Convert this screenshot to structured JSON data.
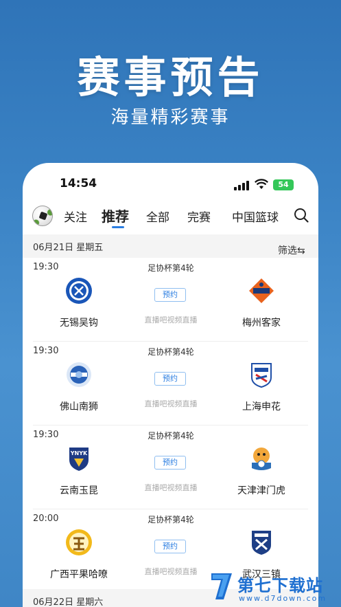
{
  "hero": {
    "title": "赛事预告",
    "subtitle": "海量精彩赛事"
  },
  "status_bar": {
    "time": "14:54",
    "battery": "54"
  },
  "tabs": [
    {
      "label": "关注"
    },
    {
      "label": "推荐",
      "active": true
    },
    {
      "label": "全部"
    },
    {
      "label": "完赛"
    },
    {
      "label": "中国篮球"
    }
  ],
  "date_header": {
    "date": "06月21日 星期五",
    "filter_label": "筛选⇆"
  },
  "matches": [
    {
      "time": "19:30",
      "league": "足协杯第4轮",
      "reserve_label": "预约",
      "source": "直播吧视频直播",
      "home": "无锡吴钩",
      "away": "梅州客家"
    },
    {
      "time": "19:30",
      "league": "足协杯第4轮",
      "reserve_label": "预约",
      "source": "直播吧视频直播",
      "home": "佛山南狮",
      "away": "上海申花"
    },
    {
      "time": "19:30",
      "league": "足协杯第4轮",
      "reserve_label": "预约",
      "source": "直播吧视频直播",
      "home": "云南玉昆",
      "away": "天津津门虎"
    },
    {
      "time": "20:00",
      "league": "足协杯第4轮",
      "reserve_label": "预约",
      "source": "直播吧视频直播",
      "home": "广西平果哈嘹",
      "away": "武汉三镇"
    }
  ],
  "next_date_header": {
    "date": "06月22日 星期六"
  },
  "watermark": {
    "brand": "第七下载站",
    "url": "www.d7down.com"
  },
  "colors": {
    "accent": "#2a7de1",
    "background_top": "#2f74b8",
    "battery": "#34c759"
  }
}
